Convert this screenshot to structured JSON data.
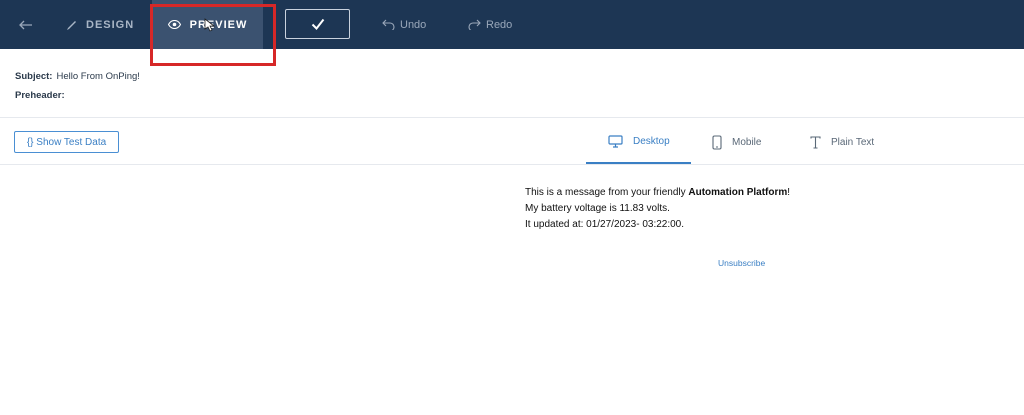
{
  "toolbar": {
    "design_label": "DESIGN",
    "preview_label": "PREVIEW",
    "undo_label": "Undo",
    "redo_label": "Redo"
  },
  "email_meta": {
    "subject_label": "Subject:",
    "subject_value": "Hello From OnPing!",
    "preheader_label": "Preheader:",
    "preheader_value": ""
  },
  "subtoolbar": {
    "test_data_label": "{} Show Test Data",
    "tabs": [
      {
        "label": "Desktop",
        "active": true
      },
      {
        "label": "Mobile",
        "active": false
      },
      {
        "label": "Plain Text",
        "active": false
      }
    ]
  },
  "email": {
    "line1_prefix": "This is a message from your friendly ",
    "line1_bold": "Automation Platform",
    "line1_suffix": "!",
    "line2": "My battery voltage is 11.83 volts.",
    "line3": "It updated at: 01/27/2023- 03:22:00.",
    "unsubscribe": "Unsubscribe"
  },
  "colors": {
    "toolbar_bg": "#1d3654",
    "preview_active_bg": "#3b5270",
    "accent": "#3a7fc4",
    "highlight": "#d62828"
  }
}
